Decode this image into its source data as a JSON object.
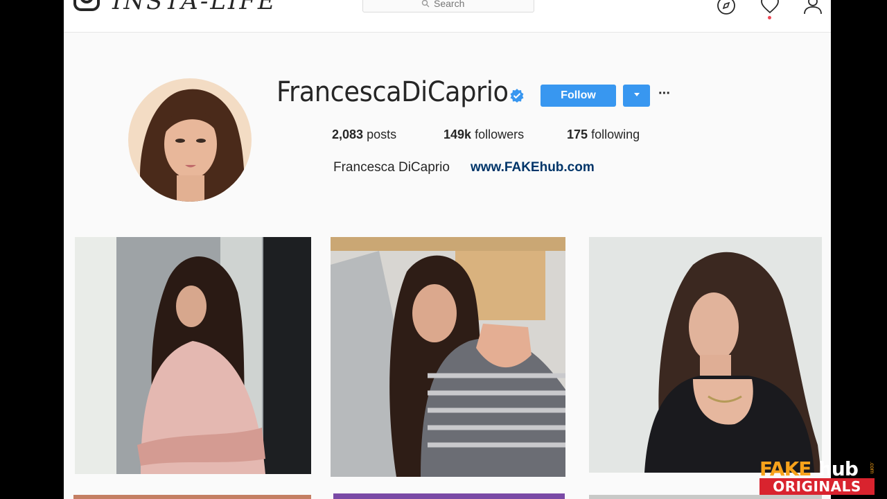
{
  "header": {
    "logo_text": "INSTA-LIFE",
    "search_placeholder": "Search"
  },
  "profile": {
    "username": "FrancescaDiCaprio",
    "verified": true,
    "follow_label": "Follow",
    "more_label": "···",
    "stats": {
      "posts_count": "2,083",
      "posts_label": "posts",
      "followers_count": "149k",
      "followers_label": "followers",
      "following_count": "175",
      "following_label": "following"
    },
    "full_name": "Francesca DiCaprio",
    "website": "www.FAKEhub.com"
  },
  "watermark": {
    "brand_left": "FAKE",
    "brand_right": "hub",
    "brand_suffix": ".com",
    "tagline": "ORIGINALS"
  },
  "colors": {
    "accent": "#3897f0",
    "link": "#003569",
    "background": "#fafafa",
    "notification": "#ed4956"
  },
  "icons": [
    "instagram-camera-icon",
    "search-icon",
    "compass-icon",
    "heart-icon",
    "user-icon",
    "verified-badge-icon",
    "chevron-down-icon"
  ]
}
